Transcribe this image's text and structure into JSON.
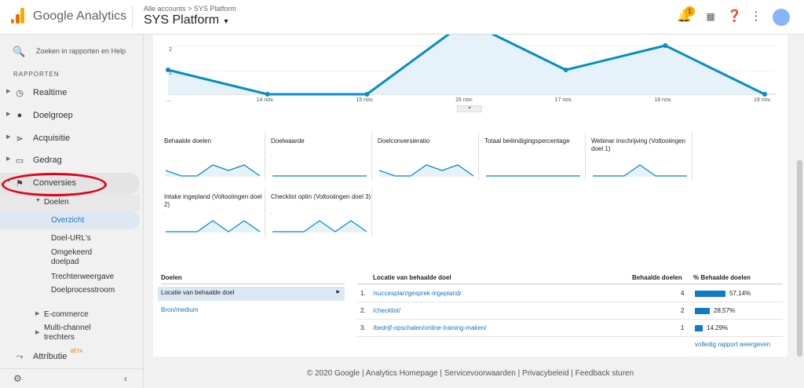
{
  "header": {
    "brand": "Google Analytics",
    "breadcrumb": "Alle accounts > SYS Platform",
    "account": "SYS Platform",
    "notification_count": "1",
    "colors": {
      "orange": "#f9ab00",
      "orange_dark": "#e37400"
    }
  },
  "sidebar": {
    "search_placeholder": "Zoeken in rapporten en Help",
    "section": "RAPPORTEN",
    "items": [
      {
        "label": "Realtime",
        "icon": "clock-icon"
      },
      {
        "label": "Doelgroep",
        "icon": "person-icon"
      },
      {
        "label": "Acquisitie",
        "icon": "acquisition-icon"
      },
      {
        "label": "Gedrag",
        "icon": "behavior-icon"
      },
      {
        "label": "Conversies",
        "icon": "flag-icon"
      }
    ],
    "sub": {
      "doelen": "Doelen",
      "overzicht": "Overzicht",
      "doel_urls": "Doel-URL's",
      "omgekeerd": "Omgekeerd doelpad",
      "trechter": "Trechterweergave",
      "doelproces": "Doelprocesstroom",
      "ecommerce": "E-commerce",
      "multichannel": "Multi-channel trechters"
    },
    "attributie": "Attributie",
    "beta": "BÈTA"
  },
  "chart_data": {
    "type": "area",
    "x": [
      "…",
      "14 nov.",
      "15 nov.",
      "16 nov.",
      "17 nov.",
      "18 nov.",
      "19 nov."
    ],
    "values": [
      1,
      0,
      0,
      3,
      1,
      2,
      0
    ],
    "yticks": [
      "2",
      "1"
    ],
    "color": "#058dc7"
  },
  "metrics": [
    {
      "title": "Behaalde doelen",
      "spark": [
        1,
        0,
        0,
        2,
        1,
        2,
        0
      ]
    },
    {
      "title": "Doelwaarde",
      "value": ":",
      "spark": [
        0,
        0,
        0,
        0,
        0,
        0,
        0
      ]
    },
    {
      "title": "Doelconversieratio",
      "spark": [
        1,
        0,
        0,
        2,
        1,
        2,
        0
      ]
    },
    {
      "title": "Totaal beëindigingspercentage",
      "spark": [
        0,
        0,
        0,
        0,
        0,
        0,
        0
      ]
    },
    {
      "title": "Webinar inschrijving (Voltooiingen doel 1)",
      "spark": [
        0,
        0,
        0,
        2,
        0,
        0,
        0
      ]
    },
    {
      "title": "Intake ingepland (Voltooiingen doel 2)",
      "value": ",",
      "spark": [
        0,
        0,
        0,
        2,
        0,
        2,
        0
      ]
    },
    {
      "title": "Checklist optin (Voltooiingen doel 3)",
      "value": ",",
      "spark": [
        0,
        0,
        0,
        2,
        0,
        2,
        0
      ]
    }
  ],
  "goals_table": {
    "left_header": "Doelen",
    "left_selected": "Locatie van behaalde doel",
    "left_other": "Bron/medium",
    "col_loc": "Locatie van behaalde doel",
    "col_count": "Behaalde doelen",
    "col_pct": "% Behaalde doelen",
    "rows": [
      {
        "n": "1.",
        "path": "/succesplan/gesprek-ingepland/",
        "count": "4",
        "pct": "57,14%",
        "frac": 0.5714
      },
      {
        "n": "2.",
        "path": "/checklist/",
        "count": "2",
        "pct": "28,57%",
        "frac": 0.2857
      },
      {
        "n": "3.",
        "path": "/bedrijf-opschalen/online-training-maken/",
        "count": "1",
        "pct": "14,29%",
        "frac": 0.1429
      }
    ],
    "full_report": "volledig rapport weergeven"
  },
  "footer": "© 2020 Google | Analytics Homepage | Servicevoorwaarden | Privacybeleid | Feedback sturen"
}
